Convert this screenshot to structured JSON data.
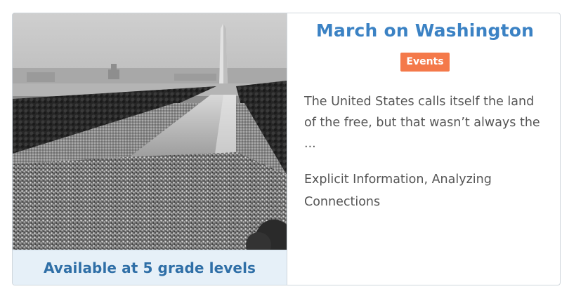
{
  "card": {
    "title": "March on Washington",
    "category_badge": "Events",
    "description_lines": [
      "The United States calls itself the land",
      "of the free, but that wasn’t always the",
      "..."
    ],
    "skills_lines": [
      "Explicit Information, Analyzing",
      "Connections"
    ],
    "grade_levels_label": "Available at 5 grade levels",
    "image": {
      "subject": "black-and-white aerial photo of crowds along the Reflecting Pool toward the Washington Monument"
    }
  },
  "colors": {
    "title": "#3b82c4",
    "badge": "#f4794a",
    "grade_bar_bg": "#e6f0f8",
    "grade_text": "#2f6fa7",
    "body_text": "#555555"
  }
}
